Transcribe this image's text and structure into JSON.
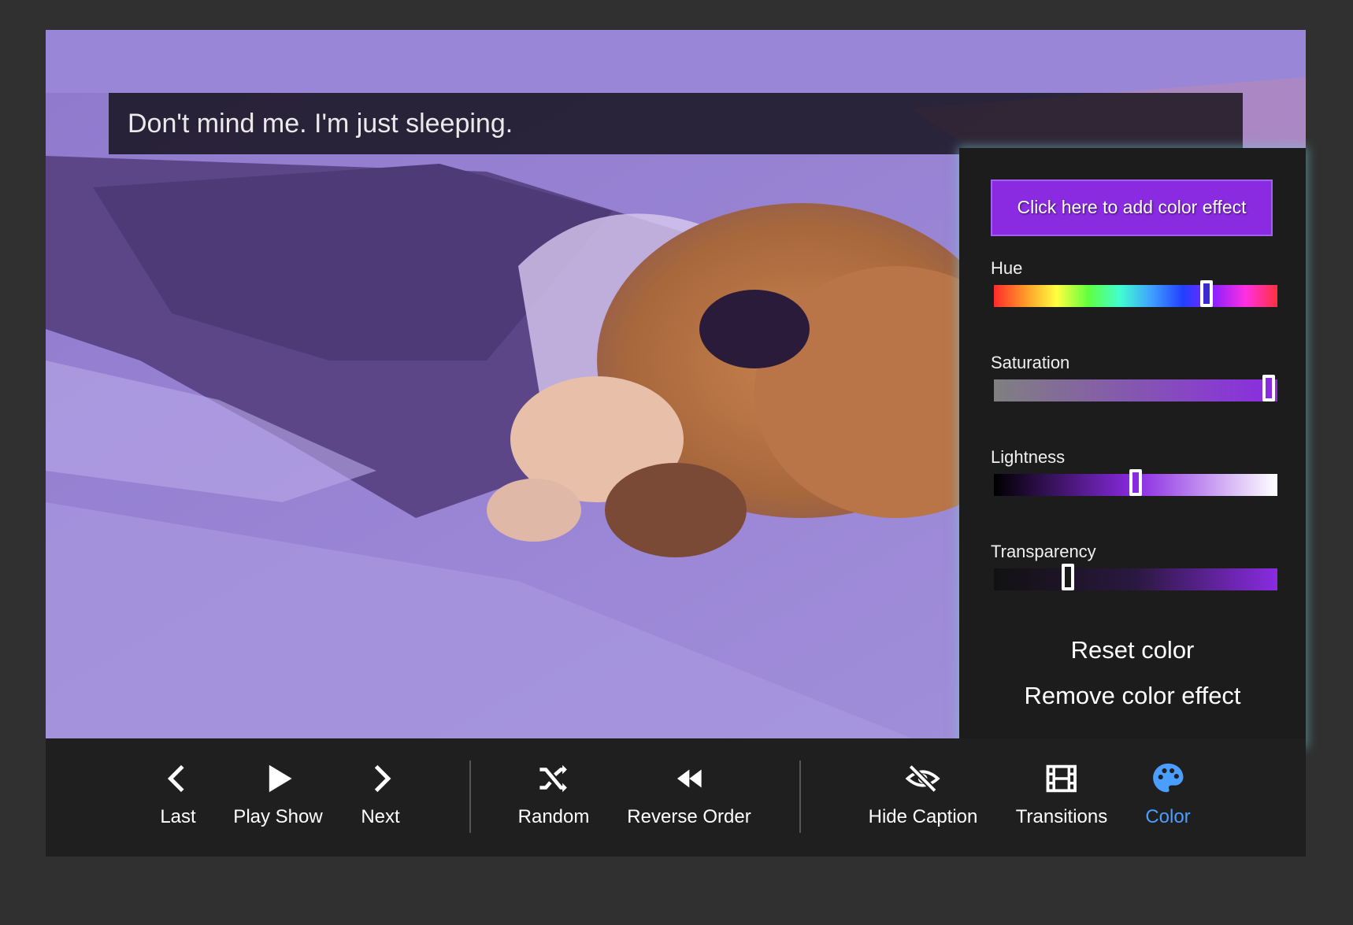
{
  "caption": "Don't mind me. I'm just sleeping.",
  "color_panel": {
    "add_button": "Click here to add color effect",
    "sliders": [
      {
        "label": "Hue",
        "value": 0.75
      },
      {
        "label": "Saturation",
        "value": 0.97
      },
      {
        "label": "Lightness",
        "value": 0.5
      },
      {
        "label": "Transparency",
        "value": 0.26
      }
    ],
    "reset_label": "Reset color",
    "remove_label": "Remove color effect"
  },
  "toolbar": {
    "buttons": [
      {
        "label": "Last",
        "icon": "chevron-left-icon"
      },
      {
        "label": "Play Show",
        "icon": "play-icon"
      },
      {
        "label": "Next",
        "icon": "chevron-right-icon"
      },
      {
        "label": "Random",
        "icon": "shuffle-icon"
      },
      {
        "label": "Reverse Order",
        "icon": "rewind-icon"
      },
      {
        "label": "Hide Caption",
        "icon": "eye-off-icon"
      },
      {
        "label": "Transitions",
        "icon": "film-icon"
      },
      {
        "label": "Color",
        "icon": "palette-icon",
        "active": true
      }
    ]
  },
  "colors": {
    "accent": "#8a2be2",
    "active_tab": "#4a9eff",
    "tint": "#8a70c6"
  }
}
